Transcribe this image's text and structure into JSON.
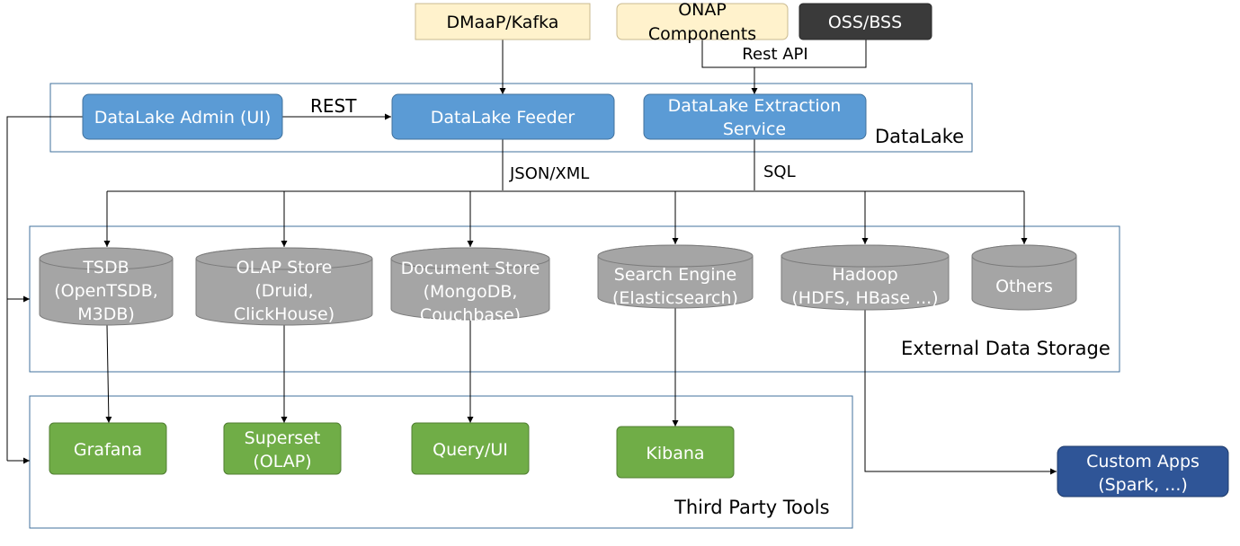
{
  "colors": {
    "blue_box": "#5b9bd5",
    "blue_border": "#41719c",
    "green_box": "#70ad47",
    "green_border": "#507e32",
    "cream_box": "#fff2cc",
    "cream_border": "#c9b98f",
    "dark_box": "#3a3a3a",
    "cylinder": "#a5a5a5",
    "cylinder_border": "#7b7b7b",
    "navy_box": "#2f5597",
    "group_border": "#41719c",
    "line": "#000000"
  },
  "sources": {
    "dmaap": "DMaaP/Kafka",
    "onap_line1": "ONAP",
    "onap_line2": "Components",
    "oss_bss": "OSS/BSS",
    "rest_api": "Rest API"
  },
  "datalake": {
    "group_label": "DataLake",
    "admin": "DataLake Admin (UI)",
    "rest_label": "REST",
    "feeder": "DataLake Feeder",
    "extraction_line1": "DataLake Extraction",
    "extraction_line2": "Service",
    "json_xml_label": "JSON/XML",
    "sql_label": "SQL"
  },
  "storage": {
    "group_label": "External Data Storage",
    "stores": [
      {
        "line1": "TSDB",
        "line2": "(OpenTSDB,",
        "line3": "M3DB)"
      },
      {
        "line1": "OLAP Store",
        "line2": "(Druid,",
        "line3": "ClickHouse)"
      },
      {
        "line1": "Document Store",
        "line2": "(MongoDB,",
        "line3": "Couchbase)"
      },
      {
        "line1": "Search Engine",
        "line2": "(Elasticsearch)"
      },
      {
        "line1": "Hadoop",
        "line2": "(HDFS, HBase ...)"
      },
      {
        "line1": "Others"
      }
    ]
  },
  "tools": {
    "group_label": "Third Party Tools",
    "grafana": "Grafana",
    "superset_line1": "Superset",
    "superset_line2": "(OLAP)",
    "query_ui": "Query/UI",
    "kibana": "Kibana"
  },
  "custom_apps": {
    "line1": "Custom Apps",
    "line2": "(Spark, ...)"
  }
}
